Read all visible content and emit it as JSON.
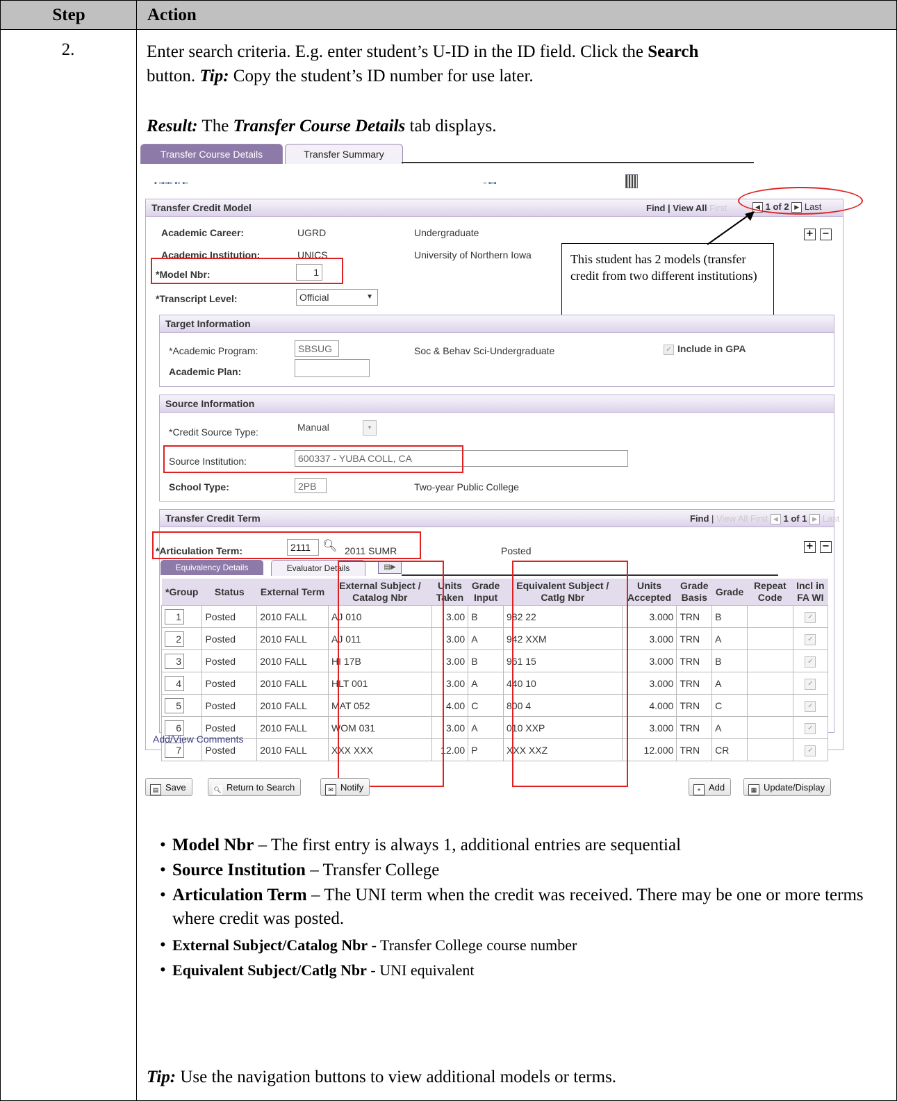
{
  "header": {
    "step": "Step",
    "action": "Action"
  },
  "step_number": "2.",
  "intro": {
    "line1_a": "Enter search criteria.  E.g. enter student’s U-ID in the ID field.  Click the ",
    "line1_b": "Search",
    "line2_a": "button.  ",
    "line2_tip": "Tip:",
    "line2_b": "  Copy the student’s ID number for use later."
  },
  "result": {
    "label": "Result:",
    "text_a": "  The ",
    "text_b": "Transfer Course Details",
    "text_c": " tab displays."
  },
  "tabs": [
    "Transfer Course Details",
    "Transfer Summary"
  ],
  "transfer_credit_model": {
    "title": "Transfer Credit Model",
    "nav": {
      "find": "Find",
      "view_all": "View All",
      "first": "First",
      "count": "1 of 2",
      "last": "Last"
    },
    "academic_career_label": "Academic Career:",
    "academic_career_code": "UGRD",
    "academic_career_desc": "Undergraduate",
    "academic_institution_label": "Academic Institution:",
    "academic_institution_code": "UNICS",
    "academic_institution_desc": "University of Northern Iowa",
    "model_nbr_label": "*Model Nbr:",
    "model_nbr_value": "1",
    "transcript_level_label": "*Transcript Level:",
    "transcript_level_value": "Official"
  },
  "callout": "This student has 2 models (transfer credit from two different institutions)",
  "target_info": {
    "title": "Target Information",
    "program_label": "*Academic Program:",
    "program_value": "SBSUG",
    "program_desc": "Soc & Behav Sci-Undergraduate",
    "include_gpa": "Include in GPA",
    "plan_label": "Academic Plan:",
    "plan_value": ""
  },
  "source_info": {
    "title": "Source Information",
    "credit_source_label": "*Credit Source Type:",
    "credit_source_value": "Manual",
    "institution_label": "Source Institution:",
    "institution_value": "600337 - YUBA COLL, CA",
    "school_type_label": "School Type:",
    "school_type_value": "2PB",
    "school_type_desc": "Two-year Public College"
  },
  "transfer_credit_term": {
    "title": "Transfer Credit Term",
    "nav": {
      "find": "Find",
      "view_all": "View All",
      "first": "First",
      "count": "1 of 1",
      "last": "Last"
    },
    "articulation_label": "*Articulation Term:",
    "articulation_value": "2111",
    "articulation_desc": "2011 SUMR",
    "status": "Posted",
    "subtabs": [
      "Equivalency Details",
      "Evaluator Details"
    ]
  },
  "grid": {
    "headers": [
      "*Group",
      "Status",
      "External Term",
      "External Subject / Catalog Nbr",
      "Units Taken",
      "Grade Input",
      "Equivalent Subject / Catlg Nbr",
      "Units Accepted",
      "Grade Basis",
      "Grade",
      "Repeat Code",
      "Incl in FA WI"
    ],
    "rows": [
      [
        "1",
        "Posted",
        "2010 FALL",
        "AJ 010",
        "3.00",
        "B",
        "982  22",
        "3.000",
        "TRN",
        "B",
        ""
      ],
      [
        "2",
        "Posted",
        "2010 FALL",
        "AJ 011",
        "3.00",
        "A",
        "942    XXM",
        "3.000",
        "TRN",
        "A",
        ""
      ],
      [
        "3",
        "Posted",
        "2010 FALL",
        "HI 17B",
        "3.00",
        "B",
        "961  15",
        "3.000",
        "TRN",
        "B",
        ""
      ],
      [
        "4",
        "Posted",
        "2010 FALL",
        "HLT 001",
        "3.00",
        "A",
        "440  10",
        "3.000",
        "TRN",
        "A",
        ""
      ],
      [
        "5",
        "Posted",
        "2010 FALL",
        "MAT 052",
        "4.00",
        "C",
        "800  4",
        "4.000",
        "TRN",
        "C",
        ""
      ],
      [
        "6",
        "Posted",
        "2010 FALL",
        "WOM 031",
        "3.00",
        "A",
        "010    XXP",
        "3.000",
        "TRN",
        "A",
        ""
      ],
      [
        "7",
        "Posted",
        "2010 FALL",
        "XXX XXX",
        "12.00",
        "P",
        "XXX    XXZ",
        "12.000",
        "TRN",
        "CR",
        ""
      ]
    ]
  },
  "add_view_comments": "Add/View Comments",
  "buttons": {
    "save": "Save",
    "return": "Return to Search",
    "notify": "Notify",
    "add": "Add",
    "update": "Update/Display"
  },
  "bullets": [
    {
      "term": "Model Nbr",
      "sep": " – ",
      "desc": "The first entry is always 1, additional entries are sequential"
    },
    {
      "term": "Source Institution",
      "sep": " – ",
      "desc": "Transfer College"
    },
    {
      "term": "Articulation Term",
      "sep": " – ",
      "desc": "The UNI term when the credit was received. There may be one or more terms where credit was posted."
    },
    {
      "term": "External Subject/Catalog Nbr",
      "sep": " - ",
      "desc": "Transfer College course number"
    },
    {
      "term": "Equivalent Subject/Catlg Nbr",
      "sep": " - ",
      "desc": "UNI equivalent"
    }
  ],
  "final_tip": {
    "label": "Tip:",
    "text": " Use the navigation buttons to view additional models or terms."
  }
}
